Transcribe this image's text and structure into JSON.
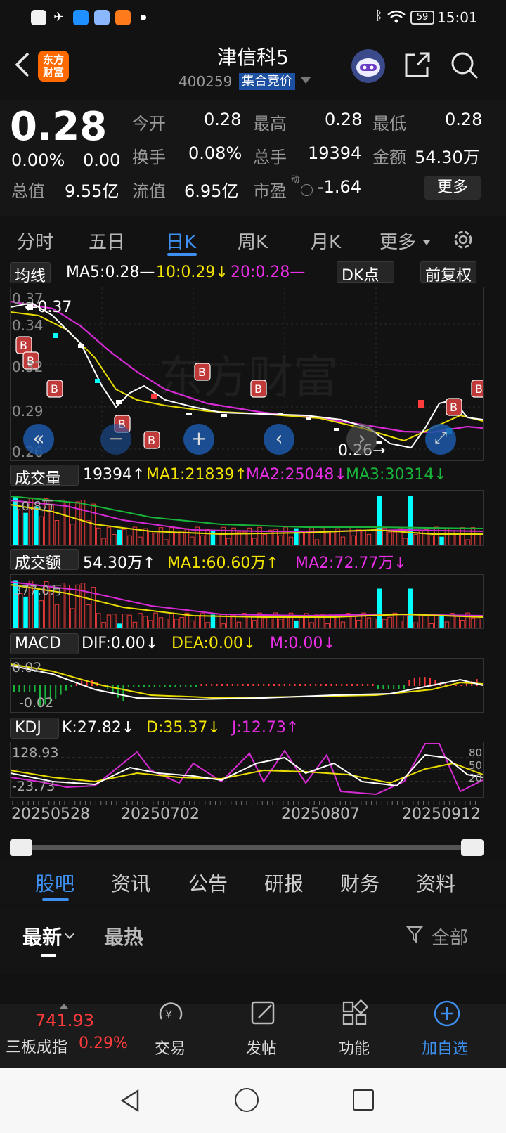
{
  "status_bar": {
    "battery": "59",
    "time": "15:01"
  },
  "header": {
    "logo": "东方\n财富",
    "title": "津信科5",
    "code": "400259",
    "session_badge": "集合竞价"
  },
  "quote": {
    "price": "0.28",
    "change_pct": "0.00%",
    "change": "0.00",
    "fields": [
      {
        "label": "今开",
        "value": "0.28"
      },
      {
        "label": "最高",
        "value": "0.28"
      },
      {
        "label": "最低",
        "value": "0.28"
      },
      {
        "label": "换手",
        "value": "0.08%"
      },
      {
        "label": "总手",
        "value": "19394"
      },
      {
        "label": "金额",
        "value": "54.30万"
      }
    ],
    "mcap_label": "总值",
    "mcap": "9.55亿",
    "float_label": "流值",
    "float": "6.95亿",
    "pe_label": "市盈",
    "pe_sup": "动",
    "pe": "-1.64",
    "more": "更多"
  },
  "chart_tabs": [
    "分时",
    "五日",
    "日K",
    "周K",
    "月K",
    "更多"
  ],
  "active_tab": "日K",
  "kline": {
    "ma_label": "均线",
    "ma5": "MA5:0.28—",
    "ma10": "10:0.29↓",
    "ma20": "20:0.28—",
    "dk": "DK点",
    "adjust": "前复权",
    "yticks": [
      "0.37",
      "0.34",
      "0.32",
      "0.29",
      "0.26"
    ],
    "high_note": "←0.37",
    "low_note": "0.26→"
  },
  "volume": {
    "sel": "成交量",
    "val": "19394↑",
    "ma1": "MA1:21839↑",
    "ma2": "MA2:25048↓",
    "ma3": "MA3:30314↓",
    "top": "10.8万"
  },
  "amount": {
    "sel": "成交额",
    "val": "54.30万↑",
    "ma1": "MA1:60.60万↑",
    "ma2": "MA2:72.77万↓",
    "top": "377.0万"
  },
  "macd": {
    "sel": "MACD",
    "dif": "DIF:0.00↓",
    "dea": "DEA:0.00↓",
    "m": "M:0.00↓",
    "top": "0.02",
    "bot": "-0.02"
  },
  "kdj": {
    "sel": "KDJ",
    "k": "K:27.82↓",
    "d": "D:35.37↓",
    "j": "J:12.73↑",
    "top": "128.93",
    "bot": "-23.73",
    "r1": "80",
    "r2": "50",
    "r3": "20"
  },
  "dates": [
    "20250528",
    "20250702",
    "20250807",
    "20250912"
  ],
  "section_tabs": [
    "股吧",
    "资讯",
    "公告",
    "研报",
    "财务",
    "资料"
  ],
  "sort": {
    "latest": "最新",
    "hot": "最热",
    "filter": "全部"
  },
  "bottom": {
    "index_val": "741.93",
    "index_name": "三板成指",
    "index_chg": "0.29%",
    "trade": "交易",
    "post": "发帖",
    "func": "功能",
    "add": "加自选"
  }
}
